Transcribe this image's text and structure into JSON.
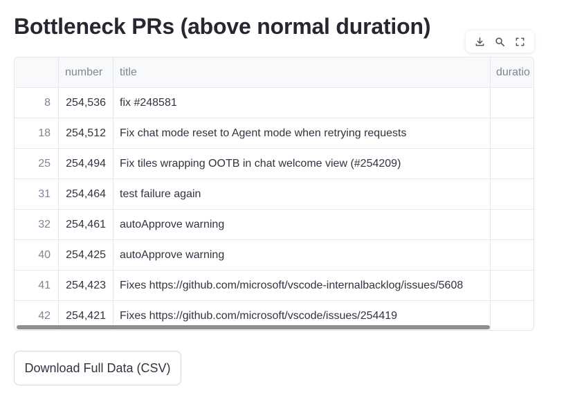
{
  "page": {
    "title": "Bottleneck PRs (above normal duration)"
  },
  "toolbar": {
    "icons": [
      "download-icon",
      "search-icon",
      "fullscreen-icon"
    ]
  },
  "table": {
    "columns": [
      "",
      "number",
      "title",
      "duratio"
    ],
    "rows": [
      {
        "index": "8",
        "number": "254,536",
        "title": "fix #248581"
      },
      {
        "index": "18",
        "number": "254,512",
        "title": "Fix chat mode reset to Agent mode when retrying requests"
      },
      {
        "index": "25",
        "number": "254,494",
        "title": "Fix tiles wrapping OOTB in chat welcome view (#254209)"
      },
      {
        "index": "31",
        "number": "254,464",
        "title": "test failure again"
      },
      {
        "index": "32",
        "number": "254,461",
        "title": "autoApprove warning"
      },
      {
        "index": "40",
        "number": "254,425",
        "title": "autoApprove warning"
      },
      {
        "index": "41",
        "number": "254,423",
        "title": "Fixes https://github.com/microsoft/vscode-internalbacklog/issues/5608"
      },
      {
        "index": "42",
        "number": "254,421",
        "title": "Fixes https://github.com/microsoft/vscode/issues/254419"
      }
    ]
  },
  "download": {
    "label": "Download Full Data (CSV)"
  }
}
